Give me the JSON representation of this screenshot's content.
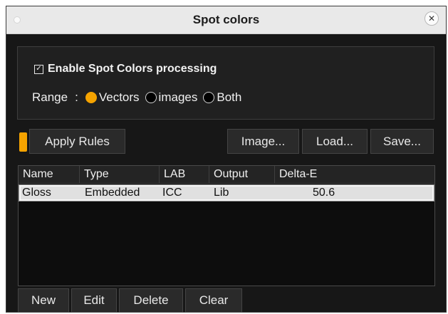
{
  "window": {
    "title": "Spot colors"
  },
  "options": {
    "enable_label": "Enable Spot Colors processing",
    "enable_checked": true,
    "range_label": "Range",
    "range_sep": ":",
    "range_options": [
      "Vectors",
      "images",
      "Both"
    ],
    "range_selected": "Vectors"
  },
  "toolbar": {
    "apply_rules": "Apply Rules",
    "image": "Image...",
    "load": "Load...",
    "save": "Save..."
  },
  "table": {
    "columns": [
      "Name",
      "Type",
      "LAB",
      "Output",
      "Delta-E"
    ],
    "rows": [
      {
        "name": "Gloss",
        "type": "Embedded",
        "lab": "ICC",
        "output": "Lib",
        "delta_e": "50.6"
      }
    ]
  },
  "bottom": {
    "new": "New",
    "edit": "Edit",
    "delete": "Delete",
    "clear": "Clear"
  },
  "colors": {
    "accent": "#f5a300",
    "panel": "#171717",
    "titlebar": "#e9e9e9"
  }
}
